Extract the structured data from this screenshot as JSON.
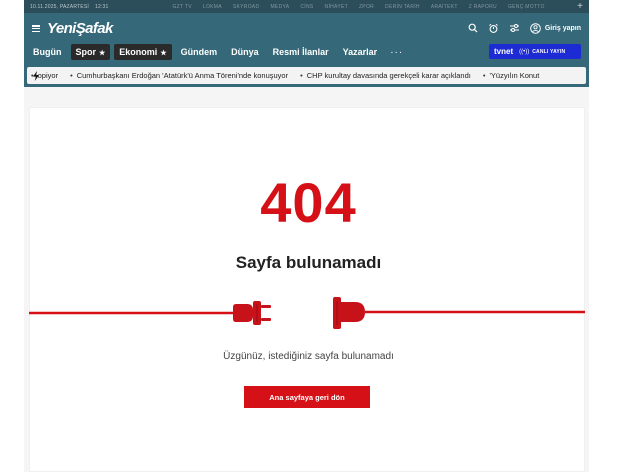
{
  "topbar": {
    "date": "10.11.2025, PAZARTESİ",
    "time": "12:31",
    "links": [
      "GZT TV",
      "LOKMA",
      "SKYROAD",
      "MEDYA",
      "CİNS",
      "NİHAYET",
      "ZPOR",
      "DERİN TARİH",
      "ARAİTEKT",
      "Z RAPORU",
      "GENÇ MOTTO"
    ],
    "plus_icon": "plus-icon"
  },
  "header": {
    "logo": "YeniŞafak",
    "login_label": "Giriş yapın",
    "icons": [
      "search-icon",
      "alarm-icon",
      "settings-sliders-icon",
      "user-icon"
    ]
  },
  "nav": {
    "items": [
      {
        "label": "Bugün"
      },
      {
        "label": "Spor",
        "star": "★"
      },
      {
        "label": "Ekonomi",
        "star": "★"
      },
      {
        "label": "Gündem"
      },
      {
        "label": "Dünya"
      },
      {
        "label": "Resmi İlanlar"
      },
      {
        "label": "Yazarlar"
      }
    ],
    "more": "···",
    "tvnet_brand": "tvnet",
    "tvnet_live": "CANLI YAYIN"
  },
  "ticker": {
    "items": [
      "opiyor",
      "Cumhurbaşkanı Erdoğan 'Atatürk'ü Anma Töreni'nde konuşuyor",
      "CHP kurultay davasında gerekçeli karar açıklandı",
      "'Yüzyılın Konut"
    ]
  },
  "error": {
    "code": "404",
    "title": "Sayfa bulunamadı",
    "message": "Üzgünüz, istediğiniz sayfa bulunamadı",
    "button_label": "Ana sayfaya geri dön"
  },
  "colors": {
    "brand_red": "#d51017",
    "header_teal": "#356878",
    "topbar_dark": "#2c4d5a",
    "tvnet_blue": "#1d2bd4"
  }
}
